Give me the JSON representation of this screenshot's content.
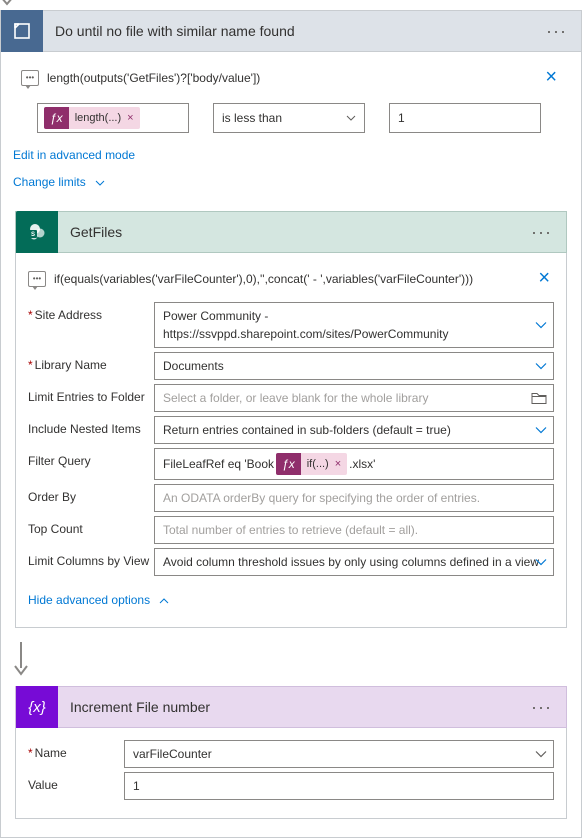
{
  "top_arrow": true,
  "loop": {
    "title": "Do until no file with similar name found",
    "expression": "length(outputs('GetFiles')?['body/value'])",
    "condition": {
      "left_token": "length(...)",
      "operator": "is less than",
      "right_value": "1"
    },
    "edit_advanced": "Edit in advanced mode",
    "change_limits": "Change limits"
  },
  "getfiles": {
    "title": "GetFiles",
    "expression": "if(equals(variables('varFileCounter'),0),'',concat(' - ',variables('varFileCounter')))",
    "fields": {
      "site_label": "Site Address",
      "site_value_1": "Power Community -",
      "site_value_2": "https://ssvppd.sharepoint.com/sites/PowerCommunity",
      "lib_label": "Library Name",
      "lib_value": "Documents",
      "limit_folder_label": "Limit Entries to Folder",
      "limit_folder_ph": "Select a folder, or leave blank for the whole library",
      "nested_label": "Include Nested Items",
      "nested_value": "Return entries contained in sub-folders (default = true)",
      "filter_label": "Filter Query",
      "filter_prefix": "FileLeafRef eq 'Book",
      "filter_token": "if(...)",
      "filter_suffix": ".xlsx'",
      "order_label": "Order By",
      "order_ph": "An ODATA orderBy query for specifying the order of entries.",
      "top_label": "Top Count",
      "top_ph": "Total number of entries to retrieve (default = all).",
      "limitcol_label": "Limit Columns by View",
      "limitcol_value": "Avoid column threshold issues by only using columns defined in a view"
    },
    "hide_advanced": "Hide advanced options"
  },
  "increment": {
    "title": "Increment File number",
    "name_label": "Name",
    "name_value": "varFileCounter",
    "value_label": "Value",
    "value_value": "1"
  }
}
